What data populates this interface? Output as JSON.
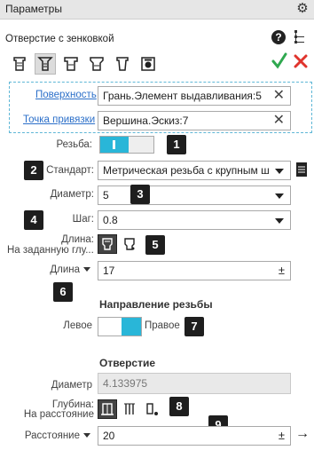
{
  "window": {
    "title": "Параметры"
  },
  "panel": {
    "subtitle": "Отверстие с зенковкой"
  },
  "hole_types": [
    {
      "name": "hole-type-simple-icon"
    },
    {
      "name": "hole-type-countersink-icon"
    },
    {
      "name": "hole-type-counterbore-icon"
    },
    {
      "name": "hole-type-combined-icon"
    },
    {
      "name": "hole-type-tapered-icon"
    },
    {
      "name": "hole-type-custom-icon"
    }
  ],
  "surface": {
    "link": "Поверхность",
    "value": "Грань.Элемент выдавливания:5"
  },
  "anchor": {
    "link": "Точка привязки",
    "value": "Вершина.Эскиз:7"
  },
  "thread": {
    "label": "Резьба:"
  },
  "standard": {
    "label": "Стандарт:",
    "value": "Метрическая резьба с крупным ш"
  },
  "diameter": {
    "label": "Диаметр:",
    "value": "5"
  },
  "pitch": {
    "label": "Шаг:",
    "value": "0.8"
  },
  "length_mode": {
    "label": "Длина:",
    "sublabel": "На заданную глу..."
  },
  "length": {
    "label": "Длина",
    "value": "17",
    "pm": "±"
  },
  "direction": {
    "title": "Направление резьбы",
    "left": "Левое",
    "right": "Правое"
  },
  "hole": {
    "title": "Отверстие",
    "diameter_label": "Диаметр",
    "diameter_value": "4.133975"
  },
  "depth": {
    "label": "Глубина:",
    "sublabel": "На расстояние"
  },
  "distance": {
    "label": "Расстояние",
    "value": "20",
    "pm": "±",
    "arrow": "→"
  },
  "badges": [
    "1",
    "2",
    "3",
    "4",
    "5",
    "6",
    "7",
    "8",
    "9"
  ],
  "colors": {
    "accent": "#29b6d8",
    "link": "#2b6fc9",
    "ok": "#2fa84f",
    "cancel": "#e0342d"
  }
}
